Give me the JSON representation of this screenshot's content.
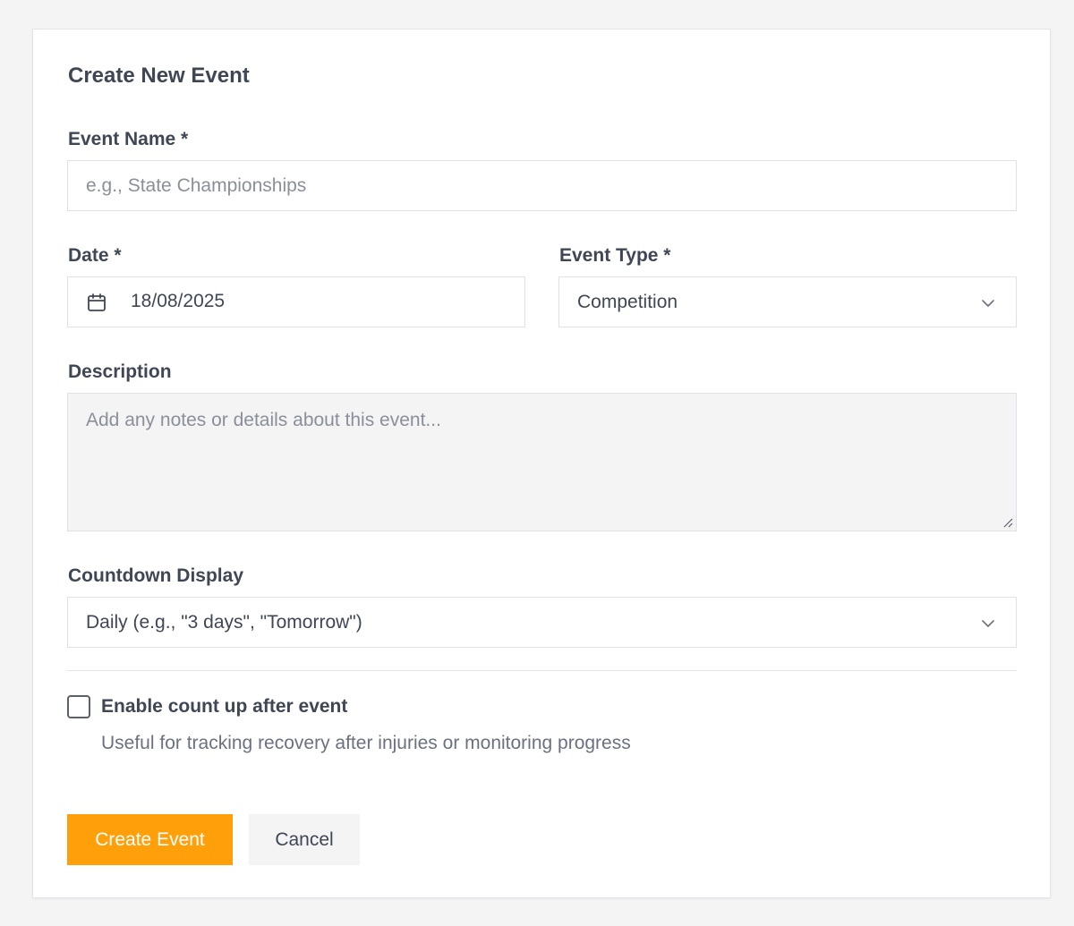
{
  "form": {
    "title": "Create New Event",
    "event_name": {
      "label": "Event Name *",
      "placeholder": "e.g., State Championships"
    },
    "date": {
      "label": "Date *",
      "value": "18/08/2025",
      "icon": "calendar-icon"
    },
    "event_type": {
      "label": "Event Type *",
      "value": "Competition"
    },
    "description": {
      "label": "Description",
      "placeholder": "Add any notes or details about this event..."
    },
    "countdown": {
      "label": "Countdown Display",
      "value": "Daily (e.g., \"3 days\", \"Tomorrow\")"
    },
    "count_up": {
      "label": "Enable count up after event",
      "help": "Useful for tracking recovery after injuries or monitoring progress",
      "checked": false
    },
    "buttons": {
      "create": "Create Event",
      "cancel": "Cancel"
    }
  },
  "colors": {
    "accent": "#ff9f0a",
    "text": "#3f4654",
    "muted": "#8a8f99",
    "border": "#dfe1e7"
  }
}
